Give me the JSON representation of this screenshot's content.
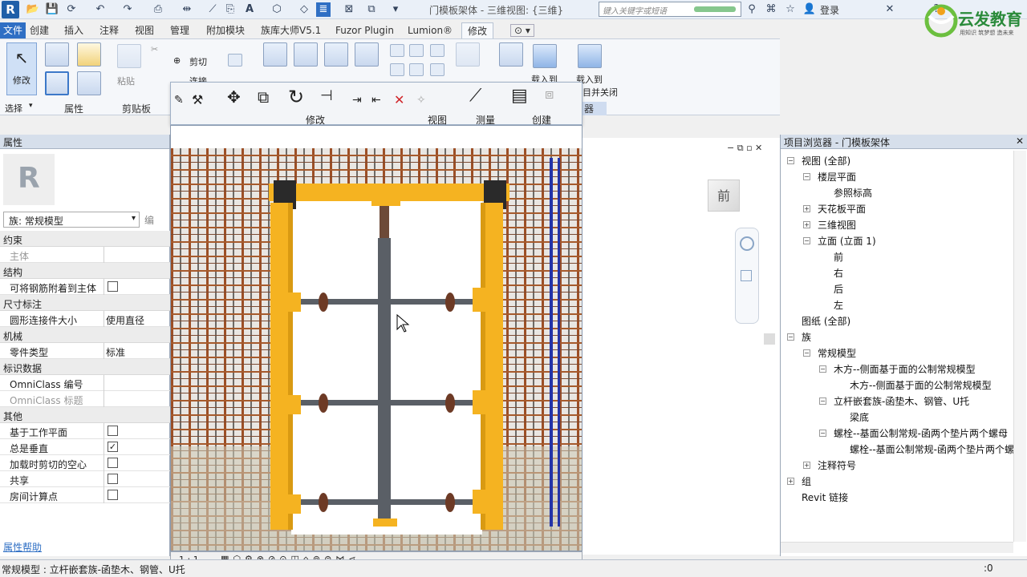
{
  "titlebar": {
    "doc_title": "门模板架体 - 三维视图: {三维}",
    "search_placeholder": "键入关键字或短语",
    "login": "登录"
  },
  "tabs": [
    "文件",
    "创建",
    "插入",
    "注释",
    "视图",
    "管理",
    "附加模块",
    "族库大师V5.1",
    "Fuzor Plugin",
    "Lumion®",
    "修改"
  ],
  "ribbon": {
    "modify": "修改",
    "select": "选择",
    "properties": "属性",
    "paste": "粘贴",
    "clipboard": "剪贴板",
    "cut": "剪切",
    "join": "连接",
    "modify_group": "修改",
    "view_group": "视图",
    "measure_group": "测量",
    "create_group": "创建",
    "load_into": "载入到",
    "load_close": "载入到",
    "load_close_sub": "目并关闭",
    "family_editor": "器"
  },
  "properties": {
    "header": "属性",
    "type_selector": "族: 常规模型",
    "edit_type": "编",
    "help": "属性帮助",
    "categories": {
      "constraints": "约束",
      "structure": "结构",
      "dimensions": "尺寸标注",
      "mechanical": "机械",
      "identity": "标识数据",
      "other": "其他"
    },
    "rows": {
      "host": {
        "label": "主体",
        "value": ""
      },
      "rebar_attach": {
        "label": "可将钢筋附着到主体",
        "value": ""
      },
      "connector_size": {
        "label": "圆形连接件大小",
        "value": "使用直径"
      },
      "part_type": {
        "label": "零件类型",
        "value": "标准"
      },
      "omniclass_num": {
        "label": "OmniClass 编号",
        "value": ""
      },
      "omniclass_title": {
        "label": "OmniClass 标题",
        "value": ""
      },
      "work_plane": {
        "label": "基于工作平面",
        "value": ""
      },
      "always_vertical": {
        "label": "总是垂直",
        "value": "✓"
      },
      "cut_void": {
        "label": "加载时剪切的空心",
        "value": ""
      },
      "shared": {
        "label": "共享",
        "value": ""
      },
      "room_calc": {
        "label": "房间计算点",
        "value": ""
      }
    }
  },
  "browser": {
    "header": "项目浏览器 - 门模板架体",
    "nodes": [
      {
        "text": "视图 (全部)",
        "toggle": "−"
      },
      {
        "text": "楼层平面",
        "toggle": "−"
      },
      {
        "text": "参照标高",
        "toggle": ""
      },
      {
        "text": "天花板平面",
        "toggle": "+"
      },
      {
        "text": "三维视图",
        "toggle": "+"
      },
      {
        "text": "立面 (立面 1)",
        "toggle": "−"
      },
      {
        "text": "前",
        "toggle": ""
      },
      {
        "text": "右",
        "toggle": ""
      },
      {
        "text": "后",
        "toggle": ""
      },
      {
        "text": "左",
        "toggle": ""
      },
      {
        "text": "图纸 (全部)",
        "toggle": ""
      },
      {
        "text": "族",
        "toggle": "−"
      },
      {
        "text": "常规模型",
        "toggle": "−"
      },
      {
        "text": "木方--侧面基于面的公制常规模型",
        "toggle": "−"
      },
      {
        "text": "木方--侧面基于面的公制常规模型",
        "toggle": ""
      },
      {
        "text": "立杆嵌套族-函垫木、钢管、U托",
        "toggle": "−"
      },
      {
        "text": "梁底",
        "toggle": ""
      },
      {
        "text": "螺栓--基面公制常规-函两个垫片两个螺母",
        "toggle": "−"
      },
      {
        "text": "螺栓--基面公制常规-函两个垫片两个螺母",
        "toggle": ""
      },
      {
        "text": "注释符号",
        "toggle": "+"
      },
      {
        "text": "组",
        "toggle": "+"
      },
      {
        "text": "Revit 链接",
        "toggle": ""
      }
    ]
  },
  "viewcube_label": "前",
  "view_scale": "1 : 1",
  "status": {
    "text": "常规模型 : 立杆嵌套族-函垫木、钢管、U托",
    "zero": ":0"
  },
  "brand": {
    "name": "云发教育",
    "slogan": "用知识 筑梦想 造未来"
  },
  "colors": {
    "accent": "#2f6fc4",
    "form_yellow": "#f5b321",
    "rebar": "#b05a2a",
    "pipe": "#5a5f66"
  }
}
